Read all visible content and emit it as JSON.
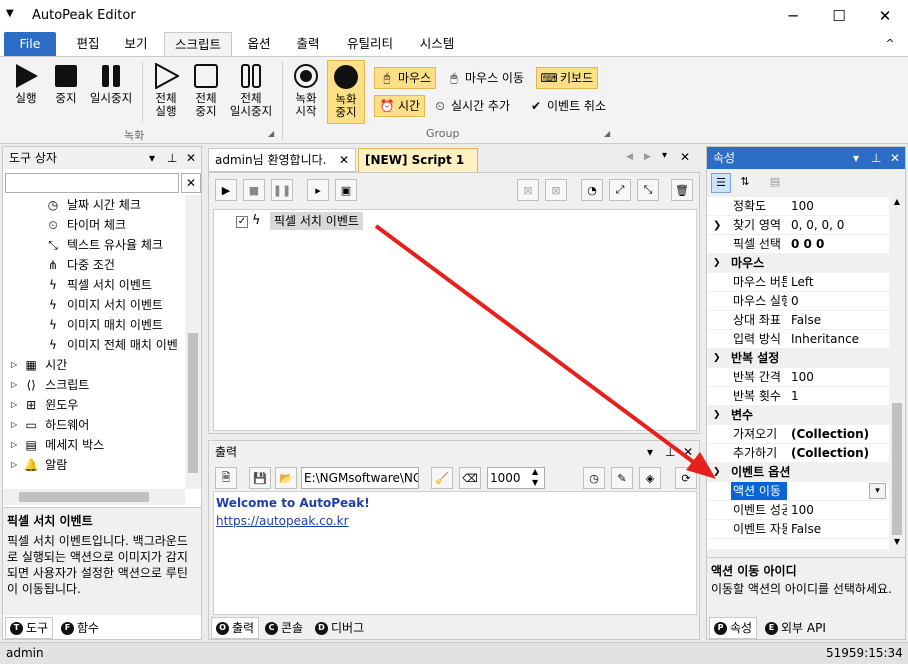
{
  "window": {
    "title": "AutoPeak Editor",
    "minimize": "─",
    "maximize": "☐",
    "close": "✕"
  },
  "menu": {
    "file": "File",
    "items": [
      "편집",
      "보기",
      "스크립트",
      "옵션",
      "출력",
      "유틸리티",
      "시스템"
    ],
    "collapse": "^"
  },
  "ribbon": {
    "run": "실행",
    "stop": "중지",
    "pause": "일시중지",
    "run_all": [
      "전체",
      "실행"
    ],
    "stop_all": [
      "전체",
      "중지"
    ],
    "pause_all": [
      "전체",
      "일시중지"
    ],
    "rec_start": [
      "녹화",
      "시작"
    ],
    "rec_stop": [
      "녹화",
      "중지"
    ],
    "mouse": "마우스",
    "mouse_move": "마우스 이동",
    "keyboard": "키보드",
    "time": "시간",
    "realtime_add": "실시간 추가",
    "event_cancel": "이벤트 취소",
    "group_record": "녹화",
    "group_group": "Group"
  },
  "toolbox": {
    "title": "도구 상자",
    "search_placeholder": "",
    "items": [
      "날짜 시간 체크",
      "타이머 체크",
      "텍스트 유사율 체크",
      "다중 조건",
      "픽셀 서치 이벤트",
      "이미지 서치 이벤트",
      "이미지 매치 이벤트",
      "이미지 전체 매치 이벤"
    ],
    "groups": [
      "시간",
      "스크립트",
      "윈도우",
      "하드웨어",
      "메세지 박스",
      "알람"
    ],
    "desc_title": "픽셀 서치 이벤트",
    "desc_text": "픽셀 서치 이벤트입니다. 백그라운드로 실행되는 액션으로 이미지가 감지되면 사용자가 설정한 액션으로 루틴이 이동됩니다.",
    "tab_tool": "도구",
    "tab_func": "함수"
  },
  "editor": {
    "tab1": "admin님 환영합니다.",
    "tab2": "[NEW] Script 1",
    "script_item": "픽셀 서치 이벤트"
  },
  "output": {
    "title": "출력",
    "path": "E:\\NGMsoftware\\NG",
    "interval": "1000",
    "welcome": "Welcome to AutoPeak!",
    "link": "https://autopeak.co.kr",
    "tab_output": "출력",
    "tab_console": "콘솔",
    "tab_debug": "디버그"
  },
  "properties": {
    "title": "속성",
    "rows_top": [
      {
        "name": "정확도",
        "value": "100"
      },
      {
        "name": "찾기 영역",
        "value": "0, 0, 0, 0"
      },
      {
        "name": "픽셀 선택",
        "value": "0 0 0"
      }
    ],
    "cat_mouse": "마우스",
    "rows_mouse": [
      {
        "name": "마우스 버튼",
        "value": "Left"
      },
      {
        "name": "마우스 실행",
        "value": "0"
      },
      {
        "name": "상대 좌표",
        "value": "False"
      },
      {
        "name": "입력 방식",
        "value": "Inheritance"
      }
    ],
    "cat_repeat": "반복 설정",
    "rows_repeat": [
      {
        "name": "반복 간격",
        "value": "100"
      },
      {
        "name": "반복 횟수",
        "value": "1"
      }
    ],
    "cat_var": "변수",
    "rows_var": [
      {
        "name": "가져오기",
        "value": "(Collection)"
      },
      {
        "name": "추가하기",
        "value": "(Collection)"
      }
    ],
    "cat_event": "이벤트 옵션",
    "rows_event": [
      {
        "name": "액션 이동",
        "value": ""
      },
      {
        "name": "이벤트 성공",
        "value": "100"
      },
      {
        "name": "이벤트 자동",
        "value": "False"
      }
    ],
    "desc_title": "액션 이동 아이디",
    "desc_text": "이동할 액션의 아이디를 선택하세요.",
    "tab_props": "속성",
    "tab_api": "외부 API"
  },
  "status": {
    "user": "admin",
    "time": "51959:15:34"
  },
  "colors": {
    "accent": "#2b6cc4",
    "highlight": "#fcdf86",
    "arrow": "#e8201c"
  }
}
